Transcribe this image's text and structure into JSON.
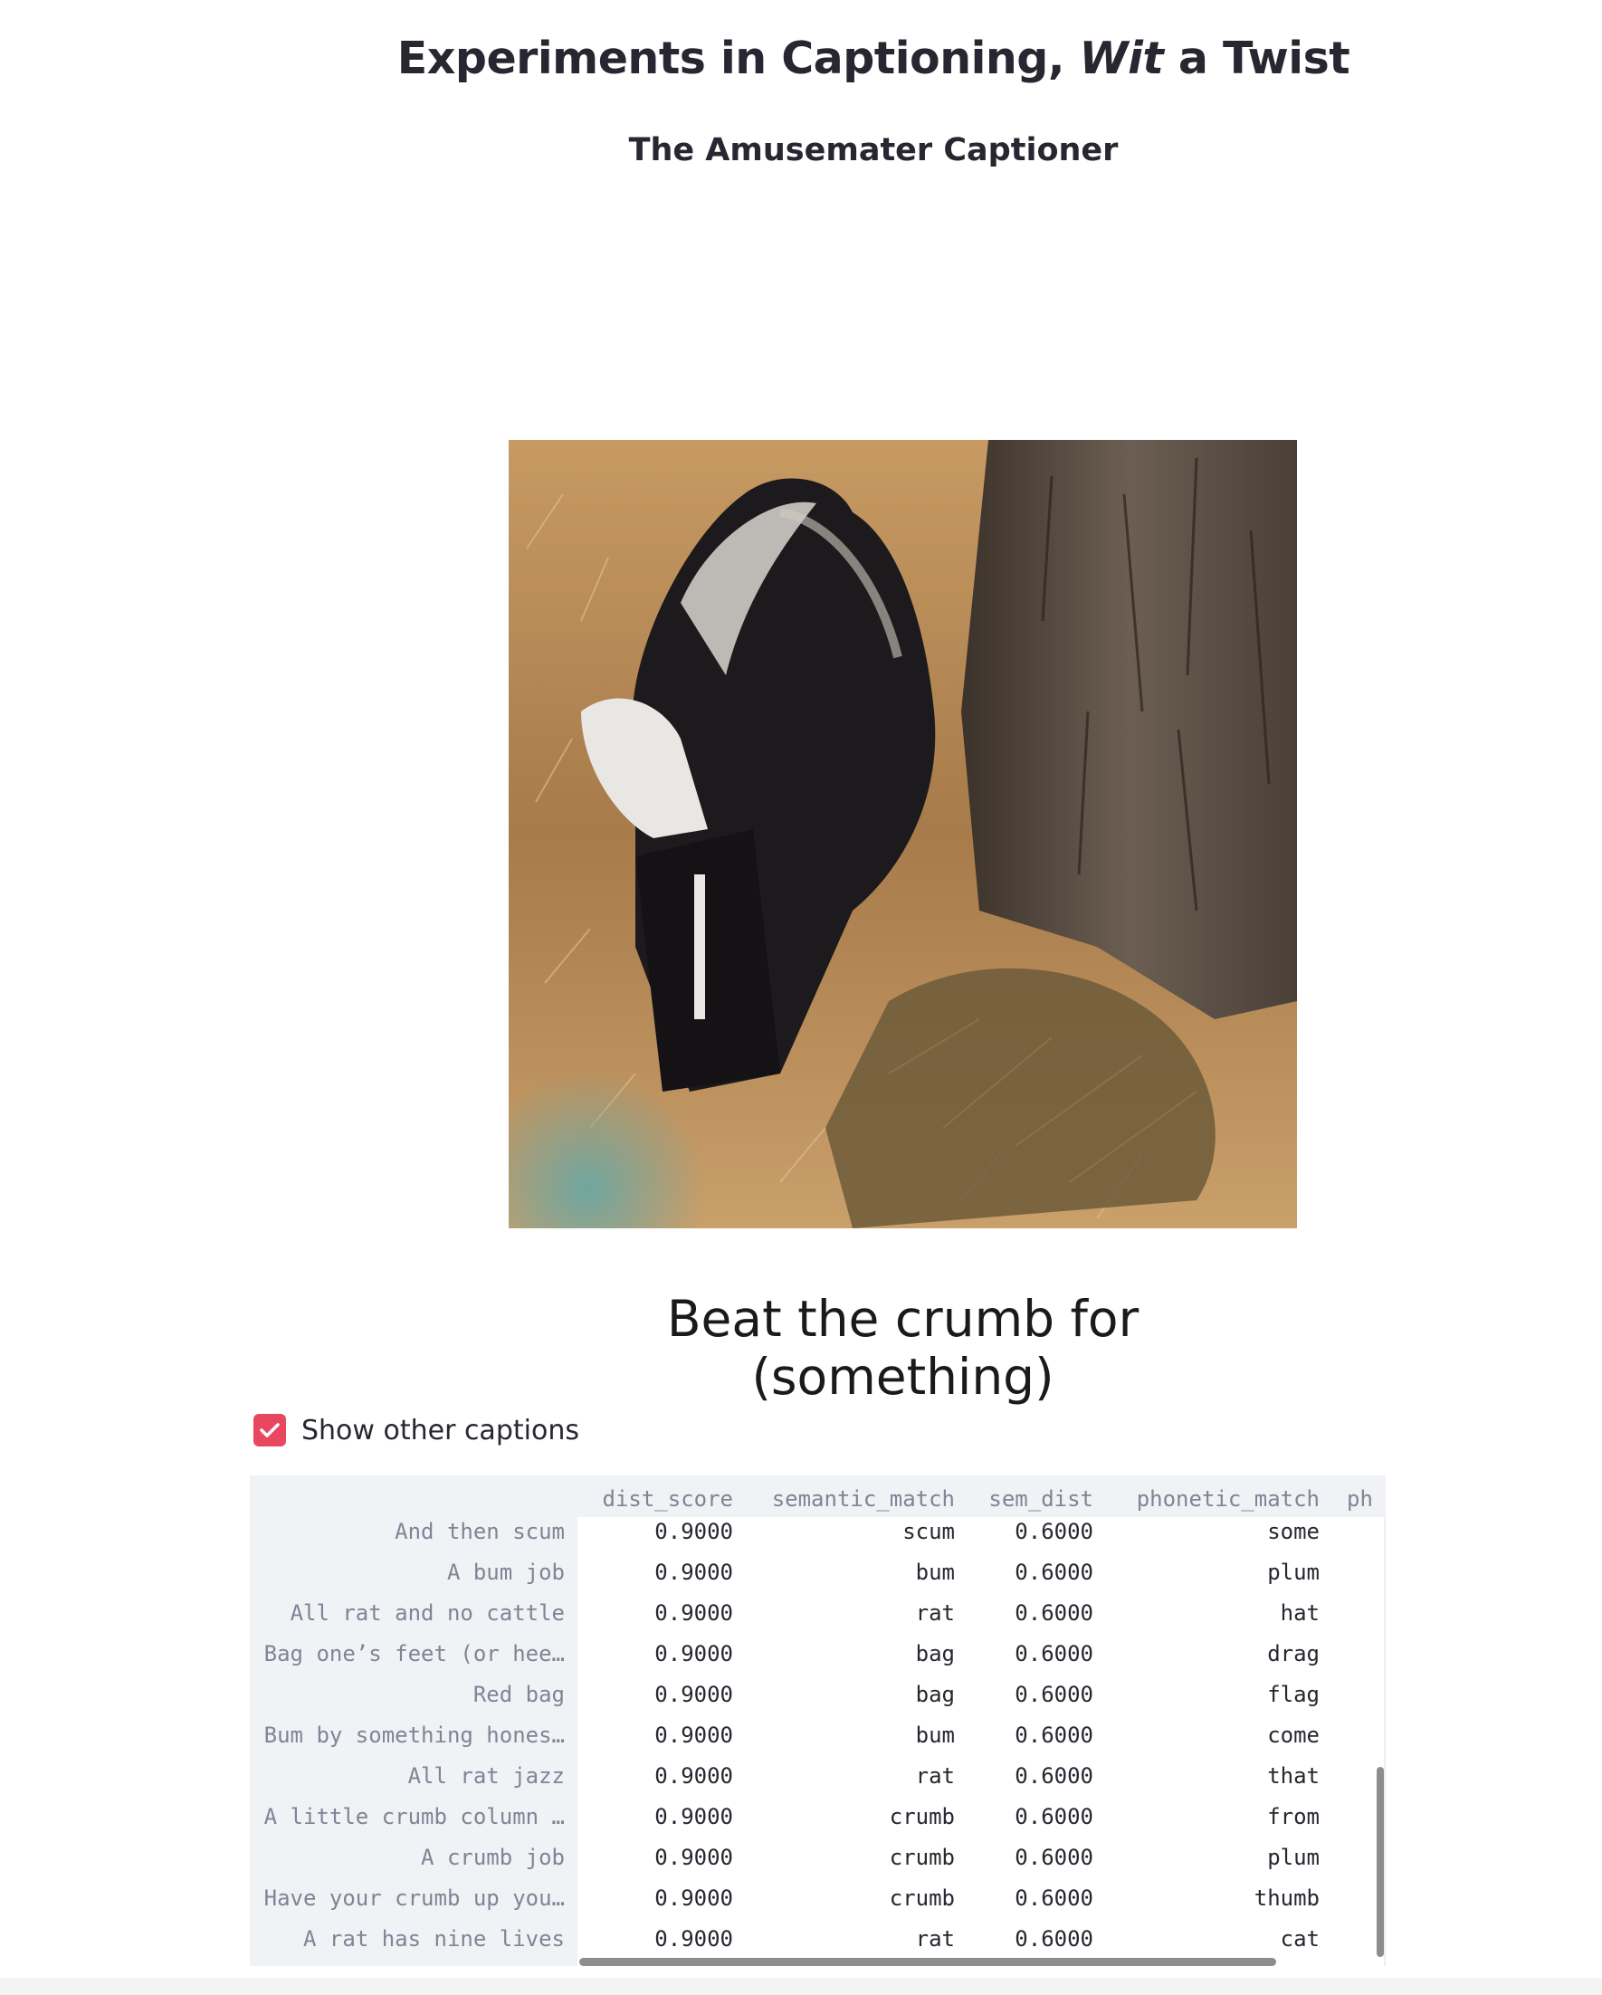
{
  "page": {
    "title_part1": "Experiments in Captioning, ",
    "title_italic": "Wit",
    "title_part2": " a Twist",
    "subtitle": "The Amusemater Captioner"
  },
  "image": {
    "description_icon": "skunk-photo"
  },
  "caption": "Beat the crumb for (something)",
  "checkbox": {
    "label": "Show other captions",
    "checked": true,
    "color": "#e8475f"
  },
  "table": {
    "columns": [
      "dist_score",
      "semantic_match",
      "sem_dist",
      "phonetic_match",
      "ph"
    ],
    "rows": [
      {
        "index": "And then scum",
        "dist_score": "0.9000",
        "semantic_match": "scum",
        "sem_dist": "0.6000",
        "phonetic_match": "some"
      },
      {
        "index": "A bum job",
        "dist_score": "0.9000",
        "semantic_match": "bum",
        "sem_dist": "0.6000",
        "phonetic_match": "plum"
      },
      {
        "index": "All rat and no cattle",
        "dist_score": "0.9000",
        "semantic_match": "rat",
        "sem_dist": "0.6000",
        "phonetic_match": "hat"
      },
      {
        "index": "Bag one’s feet (or hee…",
        "dist_score": "0.9000",
        "semantic_match": "bag",
        "sem_dist": "0.6000",
        "phonetic_match": "drag"
      },
      {
        "index": "Red bag",
        "dist_score": "0.9000",
        "semantic_match": "bag",
        "sem_dist": "0.6000",
        "phonetic_match": "flag"
      },
      {
        "index": "Bum by something hones…",
        "dist_score": "0.9000",
        "semantic_match": "bum",
        "sem_dist": "0.6000",
        "phonetic_match": "come"
      },
      {
        "index": "All rat jazz",
        "dist_score": "0.9000",
        "semantic_match": "rat",
        "sem_dist": "0.6000",
        "phonetic_match": "that"
      },
      {
        "index": "A little crumb column …",
        "dist_score": "0.9000",
        "semantic_match": "crumb",
        "sem_dist": "0.6000",
        "phonetic_match": "from"
      },
      {
        "index": "A crumb job",
        "dist_score": "0.9000",
        "semantic_match": "crumb",
        "sem_dist": "0.6000",
        "phonetic_match": "plum"
      },
      {
        "index": "Have your crumb up you…",
        "dist_score": "0.9000",
        "semantic_match": "crumb",
        "sem_dist": "0.6000",
        "phonetic_match": "thumb"
      },
      {
        "index": "A rat has nine lives",
        "dist_score": "0.9000",
        "semantic_match": "rat",
        "sem_dist": "0.6000",
        "phonetic_match": "cat"
      }
    ]
  }
}
